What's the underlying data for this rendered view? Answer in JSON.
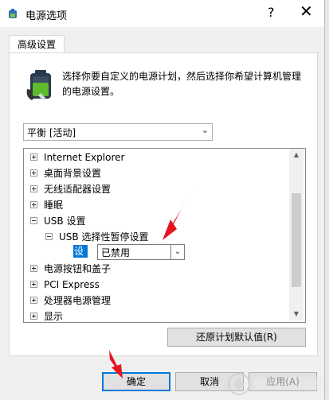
{
  "window": {
    "title": "电源选项",
    "help_label": "?",
    "close_label": "✕"
  },
  "tab": {
    "label": "高级设置"
  },
  "description": "选择你要自定义的电源计划，然后选择你希望计算机管理的电源设置。",
  "plan_select": {
    "value": "平衡 [活动]"
  },
  "tree": {
    "items": [
      {
        "label": "Internet Explorer",
        "expand": "+"
      },
      {
        "label": "桌面背景设置",
        "expand": "+"
      },
      {
        "label": "无线适配器设置",
        "expand": "+"
      },
      {
        "label": "睡眠",
        "expand": "+"
      },
      {
        "label": "USB 设置",
        "expand": "-"
      },
      {
        "label": "USB 选择性暂停设置",
        "expand": "-"
      },
      {
        "label": "电源按钮和盖子",
        "expand": "+"
      },
      {
        "label": "PCI Express",
        "expand": "+"
      },
      {
        "label": "处理器电源管理",
        "expand": "+"
      },
      {
        "label": "显示",
        "expand": "+"
      }
    ],
    "setting": {
      "label": "设置:",
      "value": "已禁用"
    }
  },
  "buttons": {
    "restore": "还原计划默认值(R)",
    "ok": "确定",
    "cancel": "取消",
    "apply": "应用(A)"
  },
  "colors": {
    "selection": "#0078d7",
    "annotation_arrow": "#e8121f"
  }
}
